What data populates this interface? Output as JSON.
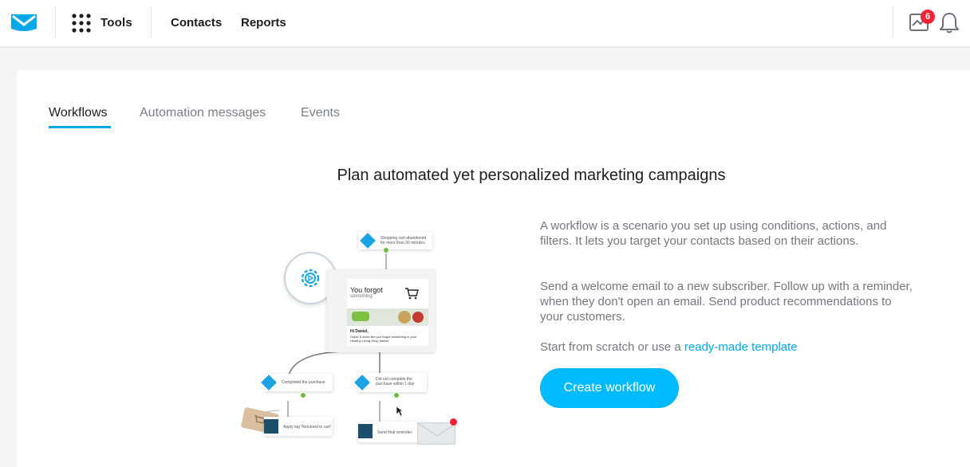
{
  "topbar": {
    "tools_label": "Tools",
    "nav": [
      "Contacts",
      "Reports"
    ],
    "notification_count": "6"
  },
  "tabs": [
    {
      "label": "Workflows",
      "active": true
    },
    {
      "label": "Automation messages",
      "active": false
    },
    {
      "label": "Events",
      "active": false
    }
  ],
  "headline": "Plan automated yet personalized marketing campaigns",
  "description": {
    "p1": "A workflow is a scenario you set up using conditions, actions, and filters. It lets you target your contacts based on their actions.",
    "p2": "Send a welcome email to a new subscriber. Follow up with a reminder, when they don't open an email. Send product recommendations to your customers.",
    "p3_prefix": "Start from scratch or use a ",
    "p3_link": "ready-made template"
  },
  "cta_label": "Create workflow",
  "illustration": {
    "node_top": "Shopping cart abandoned for more than 30 minutes",
    "email_title": "You forgot",
    "email_subtitle": "something",
    "email_greeting": "Hi Daniel,",
    "email_body": "Oops! It looks like you forgot something in your Healthy Living Shop basket",
    "node_left": "Completed the purchase",
    "node_right": "Did not complete the purchase within 1 day",
    "node_tag": "Apply tag 'Returned to cart'",
    "node_mail": "Send final reminder"
  },
  "colors": {
    "accent": "#00a8e8",
    "button": "#00baff",
    "badge": "#ee2536"
  }
}
